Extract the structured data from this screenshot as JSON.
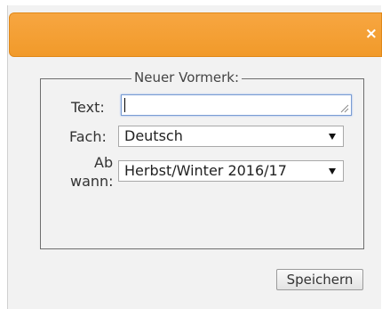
{
  "dialog": {
    "close_icon": "×",
    "legend": "Neuer Vormerk:",
    "fields": {
      "text_label": "Text:",
      "text_value": "",
      "fach_label": "Fach:",
      "fach_value": "Deutsch",
      "ab_wann_label_1": "Ab",
      "ab_wann_label_2": "wann:",
      "ab_wann_value": "Herbst/Winter 2016/17"
    },
    "save_label": "Speichern"
  }
}
